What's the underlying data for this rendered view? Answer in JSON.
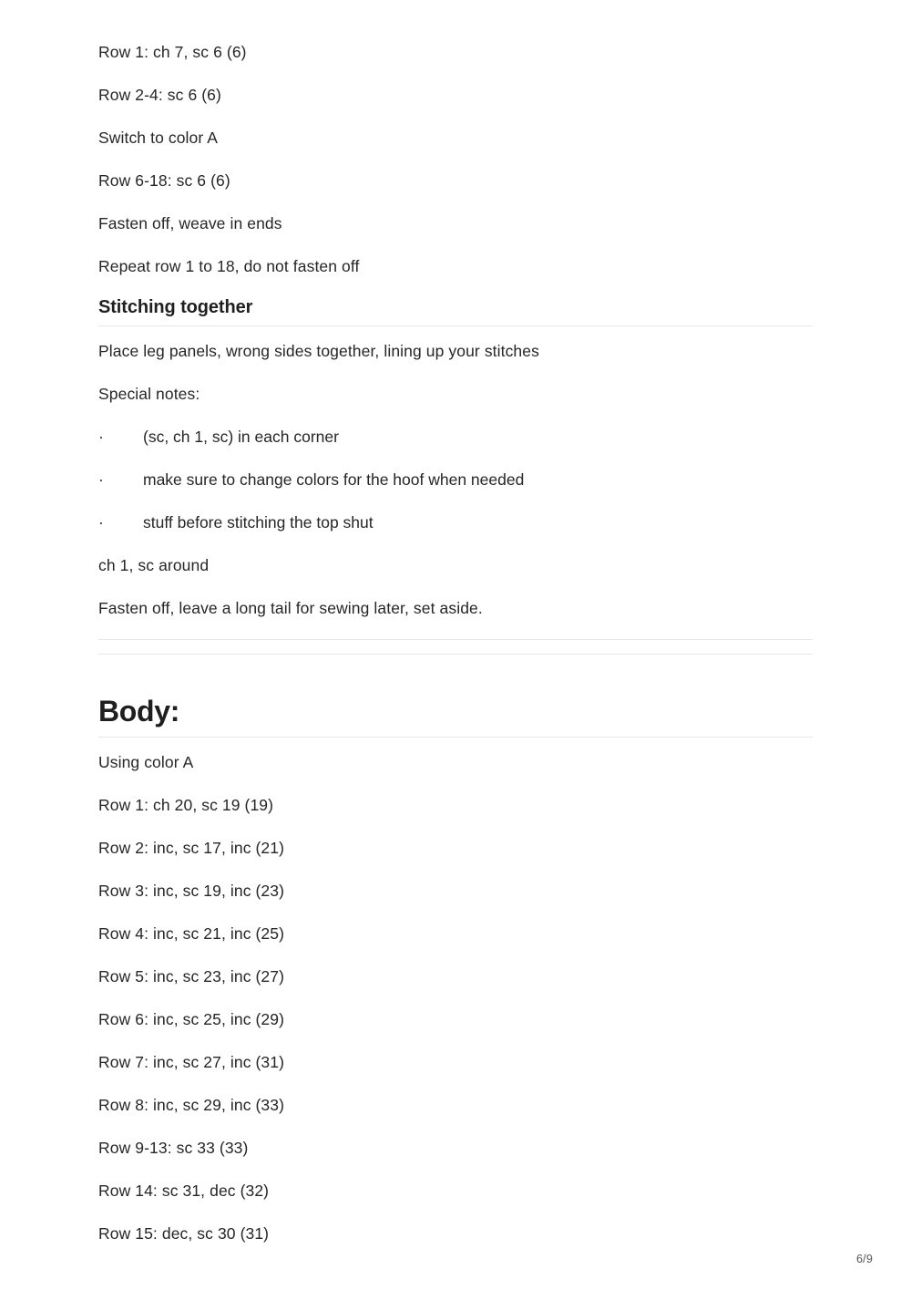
{
  "document": {
    "page_label": "6/9",
    "intro_paragraphs": [
      "Row 1: ch 7, sc 6 (6)",
      "Row 2-4: sc 6 (6)",
      "Switch to color A",
      "Row 6-18: sc 6 (6)",
      "Fasten off, weave in ends",
      "Repeat row 1 to 18, do not fasten off"
    ],
    "stitching_section": {
      "heading": "Stitching together",
      "intro": "Place leg panels, wrong sides together, lining up your stitches",
      "notes_label": "Special notes:",
      "bullet_marker": "·",
      "bullets": [
        "(sc, ch 1, sc) in each corner",
        "make sure to change colors for the hoof when needed",
        "stuff before stitching the top shut"
      ],
      "after_bullets": [
        "ch 1, sc around",
        "Fasten off, leave a long tail for sewing later, set aside."
      ]
    },
    "body_section": {
      "heading": "Body:",
      "paragraphs": [
        "Using color A",
        "Row 1: ch 20, sc 19 (19)",
        "Row 2: inc, sc 17, inc (21)",
        "Row 3: inc, sc 19, inc (23)",
        "Row 4: inc, sc 21, inc (25)",
        "Row 5: inc, sc 23, inc (27)",
        "Row 6: inc, sc 25, inc (29)",
        "Row 7: inc, sc 27, inc (31)",
        "Row 8: inc, sc 29, inc (33)",
        "Row 9-13: sc 33 (33)",
        "Row 14: sc 31, dec (32)",
        "Row 15: dec, sc 30 (31)"
      ]
    }
  }
}
